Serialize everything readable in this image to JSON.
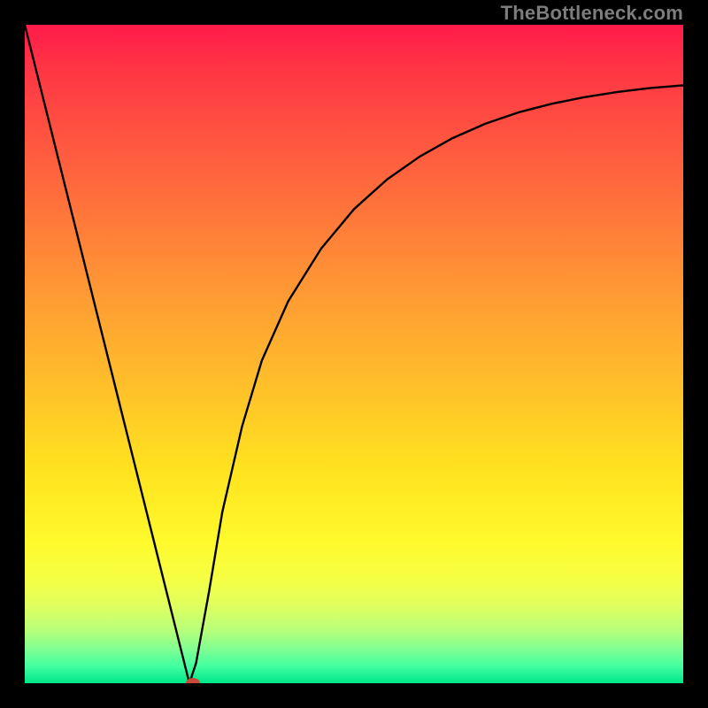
{
  "watermark": "TheBottleneck.com",
  "chart_data": {
    "type": "line",
    "title": "",
    "xlabel": "",
    "ylabel": "",
    "xlim": [
      0,
      100
    ],
    "ylim": [
      0,
      100
    ],
    "series": [
      {
        "name": "curve",
        "x": [
          0,
          5,
          10,
          15,
          20,
          22,
          24,
          25,
          26,
          28,
          30,
          33,
          36,
          40,
          45,
          50,
          55,
          60,
          65,
          70,
          75,
          80,
          85,
          90,
          95,
          100
        ],
        "y": [
          100,
          80,
          60,
          40,
          20,
          12,
          4,
          0,
          3,
          14,
          26,
          39,
          49,
          58,
          66,
          72,
          76.5,
          80,
          82.8,
          85,
          86.7,
          88,
          89,
          89.8,
          90.4,
          90.8
        ]
      }
    ],
    "marker": {
      "x": 25.5,
      "y": 0
    },
    "gradient_stops": [
      {
        "pos": 0,
        "color": "#ff1a4a"
      },
      {
        "pos": 0.18,
        "color": "#ff5740"
      },
      {
        "pos": 0.42,
        "color": "#ff9d33"
      },
      {
        "pos": 0.67,
        "color": "#ffe11f"
      },
      {
        "pos": 0.88,
        "color": "#e1ff5d"
      },
      {
        "pos": 1,
        "color": "#00e58a"
      }
    ]
  }
}
